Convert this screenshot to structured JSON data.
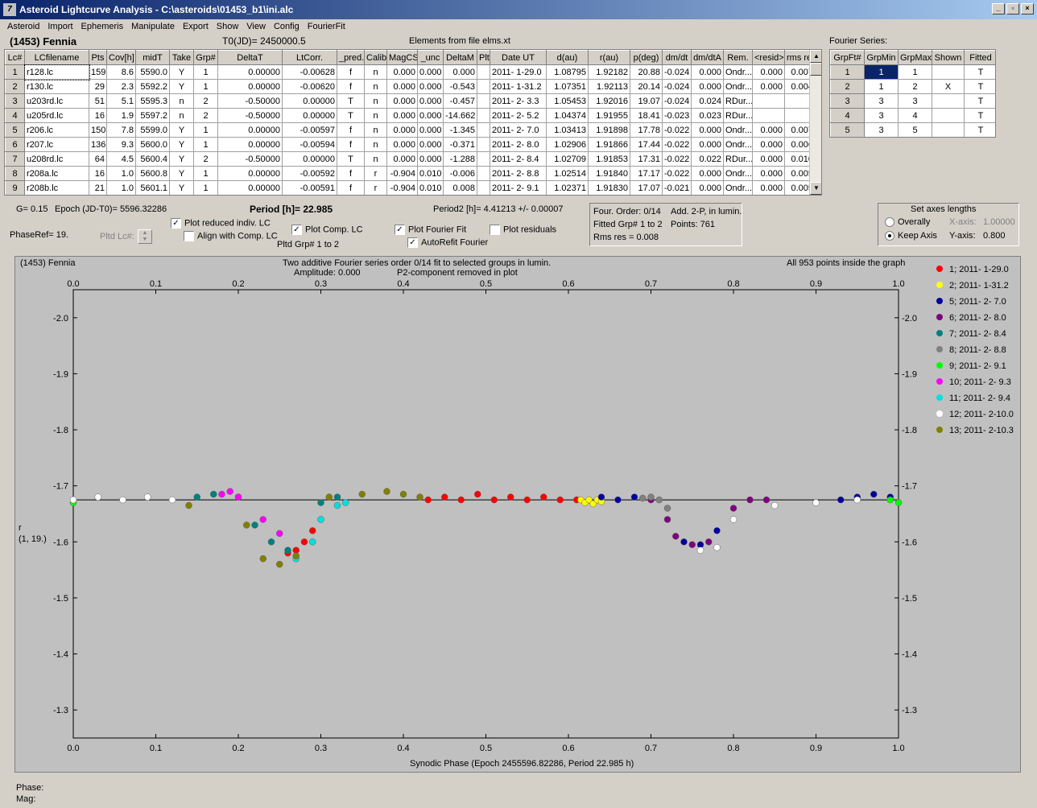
{
  "window": {
    "title": "Asteroid Lightcurve Analysis - C:\\asteroids\\01453_b1\\ini.alc",
    "app_icon": "7"
  },
  "menu": [
    "Asteroid",
    "Import",
    "Ephemeris",
    "Manipulate",
    "Export",
    "Show",
    "View",
    "Config",
    "FourierFit"
  ],
  "header": {
    "asteroid": "(1453) Fennia",
    "t0": "T0(JD)= 2450000.5",
    "elements": "Elements from file elms.xt",
    "fourier_series": "Fourier Series:"
  },
  "lc_table": {
    "columns": [
      "Lc#",
      "LCfilename",
      "Pts",
      "Cov[h]",
      "midT",
      "Take",
      "Grp#",
      "DeltaT",
      "LtCorr.",
      "_pred.",
      "Calib.",
      "MagCS",
      "_unc",
      "DeltaM",
      "Plt",
      "Date UT",
      "d(au)",
      "r(au)",
      "p(deg)",
      "dm/dt",
      "dm/dtA",
      "Rem.",
      "<resid>",
      "rms res"
    ],
    "rows": [
      [
        "1",
        "r128.lc",
        "159",
        "8.6",
        "5590.0",
        "Y",
        "1",
        "0.00000",
        "-0.00628",
        "f",
        "n",
        "0.000",
        "0.000",
        "0.000",
        "",
        "2011- 1-29.0",
        "1.08795",
        "1.92182",
        "20.88",
        "-0.024",
        "0.000",
        "Ondr...",
        "0.000",
        "0.007"
      ],
      [
        "2",
        "r130.lc",
        "29",
        "2.3",
        "5592.2",
        "Y",
        "1",
        "0.00000",
        "-0.00620",
        "f",
        "n",
        "0.000",
        "0.000",
        "-0.543",
        "",
        "2011- 1-31.2",
        "1.07351",
        "1.92113",
        "20.14",
        "-0.024",
        "0.000",
        "Ondr...",
        "0.000",
        "0.004"
      ],
      [
        "3",
        "u203rd.lc",
        "51",
        "5.1",
        "5595.3",
        "n",
        "2",
        "-0.50000",
        "0.00000",
        "T",
        "n",
        "0.000",
        "0.000",
        "-0.457",
        "",
        "2011- 2- 3.3",
        "1.05453",
        "1.92016",
        "19.07",
        "-0.024",
        "0.024",
        "RDur...",
        "",
        ""
      ],
      [
        "4",
        "u205rd.lc",
        "16",
        "1.9",
        "5597.2",
        "n",
        "2",
        "-0.50000",
        "0.00000",
        "T",
        "n",
        "0.000",
        "0.000",
        "-14.662",
        "",
        "2011- 2- 5.2",
        "1.04374",
        "1.91955",
        "18.41",
        "-0.023",
        "0.023",
        "RDur...",
        "",
        ""
      ],
      [
        "5",
        "r206.lc",
        "150",
        "7.8",
        "5599.0",
        "Y",
        "1",
        "0.00000",
        "-0.00597",
        "f",
        "n",
        "0.000",
        "0.000",
        "-1.345",
        "",
        "2011- 2- 7.0",
        "1.03413",
        "1.91898",
        "17.78",
        "-0.022",
        "0.000",
        "Ondr...",
        "0.000",
        "0.007"
      ],
      [
        "6",
        "r207.lc",
        "136",
        "9.3",
        "5600.0",
        "Y",
        "1",
        "0.00000",
        "-0.00594",
        "f",
        "n",
        "0.000",
        "0.000",
        "-0.371",
        "",
        "2011- 2- 8.0",
        "1.02906",
        "1.91866",
        "17.44",
        "-0.022",
        "0.000",
        "Ondr...",
        "0.000",
        "0.006"
      ],
      [
        "7",
        "u208rd.lc",
        "64",
        "4.5",
        "5600.4",
        "Y",
        "2",
        "-0.50000",
        "0.00000",
        "T",
        "n",
        "0.000",
        "0.000",
        "-1.288",
        "",
        "2011- 2- 8.4",
        "1.02709",
        "1.91853",
        "17.31",
        "-0.022",
        "0.022",
        "RDur...",
        "0.000",
        "0.010"
      ],
      [
        "8",
        "r208a.lc",
        "16",
        "1.0",
        "5600.8",
        "Y",
        "1",
        "0.00000",
        "-0.00592",
        "f",
        "r",
        "-0.904",
        "0.010",
        "-0.006",
        "",
        "2011- 2- 8.8",
        "1.02514",
        "1.91840",
        "17.17",
        "-0.022",
        "0.000",
        "Ondr...",
        "0.000",
        "0.005"
      ],
      [
        "9",
        "r208b.lc",
        "21",
        "1.0",
        "5601.1",
        "Y",
        "1",
        "0.00000",
        "-0.00591",
        "f",
        "r",
        "-0.904",
        "0.010",
        "0.008",
        "",
        "2011- 2- 9.1",
        "1.02371",
        "1.91830",
        "17.07",
        "-0.021",
        "0.000",
        "Ondr...",
        "0.000",
        "0.005"
      ]
    ]
  },
  "fourier_table": {
    "columns": [
      "GrpFt#",
      "GrpMin",
      "GrpMax",
      "Shown",
      "Fitted"
    ],
    "rows": [
      [
        "1",
        "1",
        "1",
        "",
        "T"
      ],
      [
        "2",
        "1",
        "2",
        "X",
        "T"
      ],
      [
        "3",
        "3",
        "3",
        "",
        "T"
      ],
      [
        "4",
        "3",
        "4",
        "",
        "T"
      ],
      [
        "5",
        "3",
        "5",
        "",
        "T"
      ]
    ]
  },
  "info": {
    "g": "G= 0.15",
    "epoch": "Epoch (JD-T0)= 5596.32286",
    "period": "Period [h]= 22.985",
    "period2": "Period2 [h]= 4.41213 +/- 0.00007",
    "phaseref": "PhaseRef= 19.",
    "pltd_lc": "Pltd Lc#:",
    "pltd_grp": "Pltd Grp#  1   to   2"
  },
  "checks": {
    "plot_reduced": {
      "label": "Plot reduced indiv. LC",
      "checked": true
    },
    "align_comp": {
      "label": "Align with Comp. LC",
      "checked": false
    },
    "plot_comp": {
      "label": "Plot Comp. LC",
      "checked": true
    },
    "plot_fourier": {
      "label": "Plot Fourier Fit",
      "checked": true
    },
    "autorefit": {
      "label": "AutoRefit Fourier",
      "checked": true
    },
    "plot_residuals": {
      "label": "Plot residuals",
      "checked": false
    }
  },
  "fit_info": {
    "four_order": "Four. Order:  0/14",
    "add": "Add. 2-P, in lumin.",
    "fitted": "Fitted Grp# 1 to 2",
    "points": "Points: 761",
    "rms": "Rms res     = 0.008"
  },
  "axes_box": {
    "title": "Set axes lengths",
    "overally": "Overally",
    "keep_axis": "Keep Axis",
    "x_axis_label": "X-axis:",
    "x_axis_value": "1.00000",
    "y_axis_label": "Y-axis:",
    "y_axis_value": "0.800"
  },
  "plot": {
    "name": "(1453) Fennia",
    "subtitle1": "Two additive Fourier series order 0/14 fit to selected groups in lumin.",
    "subtitle2_a": "Amplitude: 0.000",
    "subtitle2_b": "P2-component removed in plot",
    "points_note": "All 953 points inside the graph",
    "ylabel1": "r",
    "ylabel2": "(1, 19.)",
    "xlabel": "Synodic Phase (Epoch 2455596.82286, Period 22.985 h)"
  },
  "status": {
    "phase": "Phase:",
    "mag": "Mag:"
  },
  "chart_data": {
    "type": "scatter",
    "title": "Two additive Fourier series order 0/14 fit to selected groups in lumin.",
    "xlabel": "Synodic Phase (Epoch 2455596.82286, Period 22.985 h)",
    "ylabel": "r (1, 19.)",
    "xlim": [
      0.0,
      1.0
    ],
    "ylim": [
      -2.05,
      -1.25
    ],
    "y_inverted": true,
    "x_ticks": [
      "0.0",
      "0.1",
      "0.2",
      "0.3",
      "0.4",
      "0.5",
      "0.6",
      "0.7",
      "0.8",
      "0.9",
      "1.0"
    ],
    "y_ticks": [
      "-2.0",
      "-1.9",
      "-1.8",
      "-1.7",
      "-1.6",
      "-1.5",
      "-1.4",
      "-1.3"
    ],
    "fit_line_y": -1.675,
    "legend_position": "right",
    "series": [
      {
        "name": "1; 2011- 1-29.0",
        "color": "#ff0000",
        "x": [
          0.43,
          0.45,
          0.47,
          0.49,
          0.51,
          0.53,
          0.55,
          0.57,
          0.59,
          0.61,
          0.27,
          0.28,
          0.29,
          0.26
        ],
        "y": [
          -1.675,
          -1.68,
          -1.675,
          -1.685,
          -1.675,
          -1.68,
          -1.675,
          -1.68,
          -1.675,
          -1.675,
          -1.585,
          -1.6,
          -1.62,
          -1.58
        ]
      },
      {
        "name": "2; 2011- 1-31.2",
        "color": "#ffff00",
        "x": [
          0.615,
          0.62,
          0.625,
          0.63,
          0.635,
          0.64
        ],
        "y": [
          -1.675,
          -1.67,
          -1.675,
          -1.668,
          -1.675,
          -1.672
        ]
      },
      {
        "name": "5; 2011- 2- 7.0",
        "color": "#0000a0",
        "x": [
          0.64,
          0.66,
          0.68,
          0.74,
          0.76,
          0.78,
          0.93,
          0.95,
          0.97,
          0.99
        ],
        "y": [
          -1.68,
          -1.675,
          -1.68,
          -1.6,
          -1.595,
          -1.62,
          -1.675,
          -1.68,
          -1.685,
          -1.68
        ]
      },
      {
        "name": "6; 2011- 2- 8.0",
        "color": "#800080",
        "x": [
          0.7,
          0.72,
          0.73,
          0.75,
          0.77,
          0.8,
          0.82,
          0.84
        ],
        "y": [
          -1.675,
          -1.64,
          -1.61,
          -1.595,
          -1.6,
          -1.66,
          -1.675,
          -1.675
        ]
      },
      {
        "name": "7; 2011- 2- 8.4",
        "color": "#008080",
        "x": [
          0.15,
          0.17,
          0.2,
          0.22,
          0.24,
          0.26,
          0.3,
          0.32
        ],
        "y": [
          -1.68,
          -1.685,
          -1.68,
          -1.63,
          -1.6,
          -1.585,
          -1.67,
          -1.68
        ]
      },
      {
        "name": "8; 2011- 2- 8.8",
        "color": "#808080",
        "x": [
          0.69,
          0.7,
          0.71,
          0.72
        ],
        "y": [
          -1.678,
          -1.68,
          -1.675,
          -1.66
        ]
      },
      {
        "name": "9; 2011- 2- 9.1",
        "color": "#00ff00",
        "x": [
          0.0,
          0.99,
          1.0
        ],
        "y": [
          -1.67,
          -1.675,
          -1.67
        ]
      },
      {
        "name": "10; 2011- 2- 9.3",
        "color": "#ff00ff",
        "x": [
          0.18,
          0.19,
          0.2,
          0.23,
          0.25
        ],
        "y": [
          -1.685,
          -1.69,
          -1.68,
          -1.64,
          -1.615
        ]
      },
      {
        "name": "11; 2011- 2- 9.4",
        "color": "#00e0e0",
        "x": [
          0.27,
          0.29,
          0.3,
          0.32,
          0.33
        ],
        "y": [
          -1.57,
          -1.6,
          -1.64,
          -1.665,
          -1.67
        ]
      },
      {
        "name": "12; 2011- 2-10.0",
        "color": "#ffffff",
        "x": [
          0.0,
          0.03,
          0.06,
          0.09,
          0.12,
          0.78,
          0.76,
          0.8,
          0.85,
          0.9,
          0.95
        ],
        "y": [
          -1.675,
          -1.68,
          -1.675,
          -1.68,
          -1.675,
          -1.59,
          -1.585,
          -1.64,
          -1.665,
          -1.67,
          -1.675
        ]
      },
      {
        "name": "13; 2011- 2-10.3",
        "color": "#808000",
        "x": [
          0.14,
          0.21,
          0.23,
          0.25,
          0.27,
          0.31,
          0.35,
          0.38,
          0.4,
          0.42
        ],
        "y": [
          -1.665,
          -1.63,
          -1.57,
          -1.56,
          -1.575,
          -1.68,
          -1.685,
          -1.69,
          -1.685,
          -1.68
        ]
      }
    ]
  }
}
